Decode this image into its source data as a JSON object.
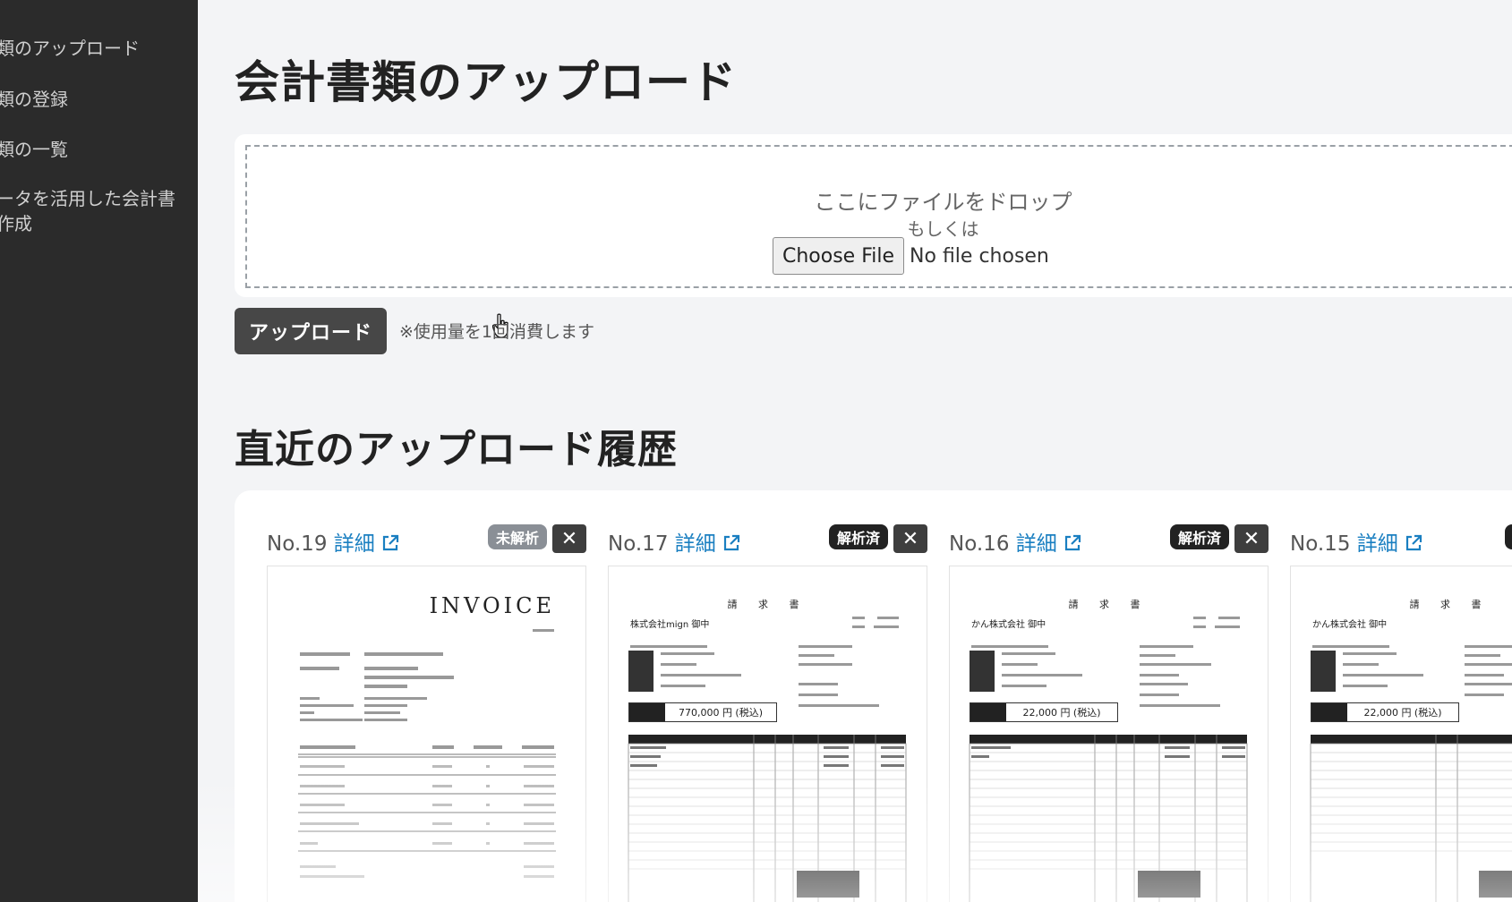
{
  "sidebar": {
    "items": [
      {
        "label": "類のアップロード"
      },
      {
        "label": "類の登録"
      },
      {
        "label": "類の一覧"
      },
      {
        "label": "ータを活用した会計書"
      },
      {
        "label": "作成"
      }
    ]
  },
  "upload": {
    "title": "会計書類のアップロード",
    "drop_text": "ここにファイルをドロップ",
    "or_text": "もしくは",
    "choose_label": "Choose File",
    "no_file_text": "No file chosen",
    "upload_button": "アップロード",
    "usage_note": "※使用量を1回消費します"
  },
  "history": {
    "title": "直近のアップロード履歴",
    "delete_label": "✕",
    "items": [
      {
        "no": "No.19",
        "detail": "詳細",
        "status": "未解析",
        "status_color": "#8a8f96",
        "doc_title": "INVOICE"
      },
      {
        "no": "No.17",
        "detail": "詳細",
        "status": "解析済",
        "status_color": "#222222",
        "doc_title": "請 求 書",
        "billed_to": "株式会社mign 御中",
        "amount": "770,000 円 (税込)"
      },
      {
        "no": "No.16",
        "detail": "詳細",
        "status": "解析済",
        "status_color": "#222222",
        "doc_title": "請 求 書",
        "billed_to": "かん株式会社 御中",
        "amount": "22,000 円 (税込)"
      },
      {
        "no": "No.15",
        "detail": "詳細",
        "doc_title": "請 求 書",
        "billed_to": "かん株式会社 御中",
        "amount": "22,000 円 (税込)"
      }
    ]
  },
  "colors": {
    "sidebar_bg": "#2b2b2b",
    "link": "#1a7fc1",
    "upload_button_bg": "#474747",
    "page_bg": "#f3f4f6"
  }
}
